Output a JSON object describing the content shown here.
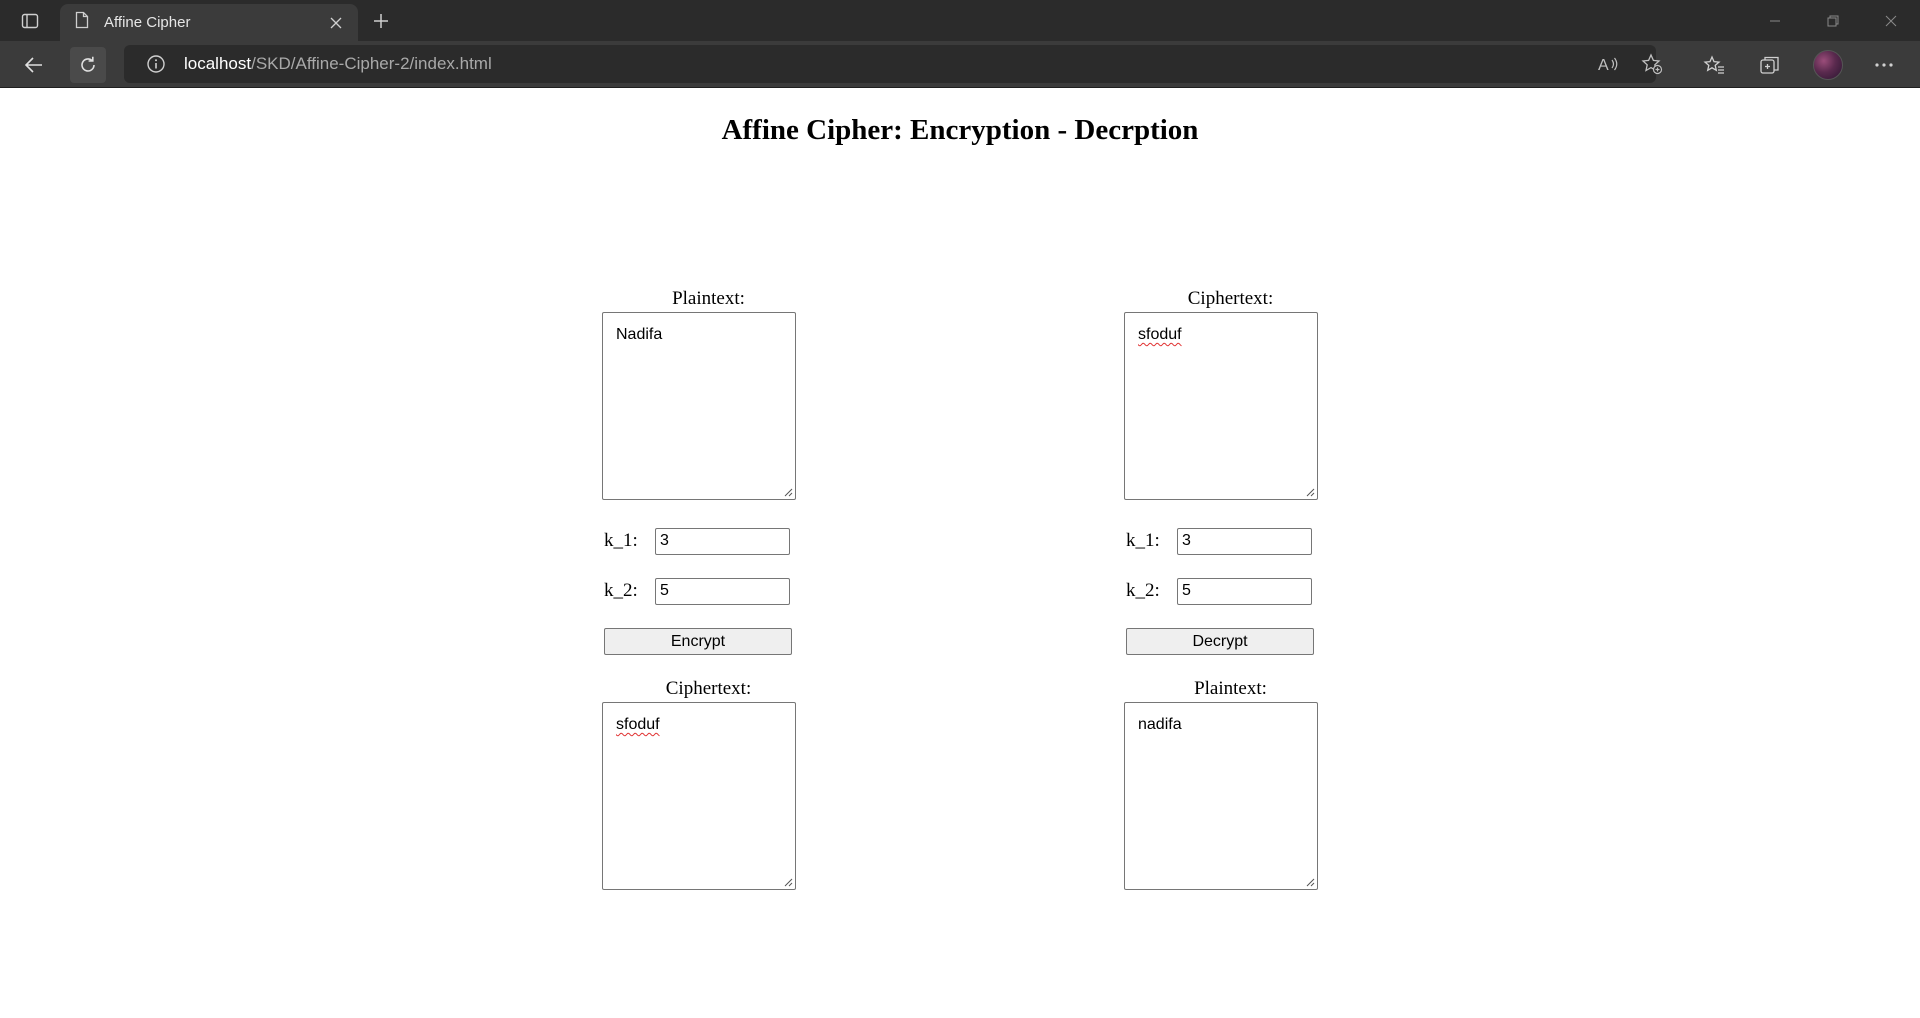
{
  "browser": {
    "tab_title": "Affine Cipher",
    "url_host": "localhost",
    "url_path": "/SKD/Affine-Cipher-2/index.html"
  },
  "page": {
    "title": "Affine Cipher: Encryption - Decrption"
  },
  "encrypt_panel": {
    "input_label": "Plaintext:",
    "input_value": "Nadifa",
    "k1_label": "k_1:",
    "k1_value": "3",
    "k2_label": "k_2:",
    "k2_value": "5",
    "button_label": "Encrypt",
    "output_label": "Ciphertext:",
    "output_value": "sfoduf"
  },
  "decrypt_panel": {
    "input_label": "Ciphertext:",
    "input_value": "sfoduf",
    "k1_label": "k_1:",
    "k1_value": "3",
    "k2_label": "k_2:",
    "k2_value": "5",
    "button_label": "Decrypt",
    "output_label": "Plaintext:",
    "output_value": "nadifa"
  }
}
